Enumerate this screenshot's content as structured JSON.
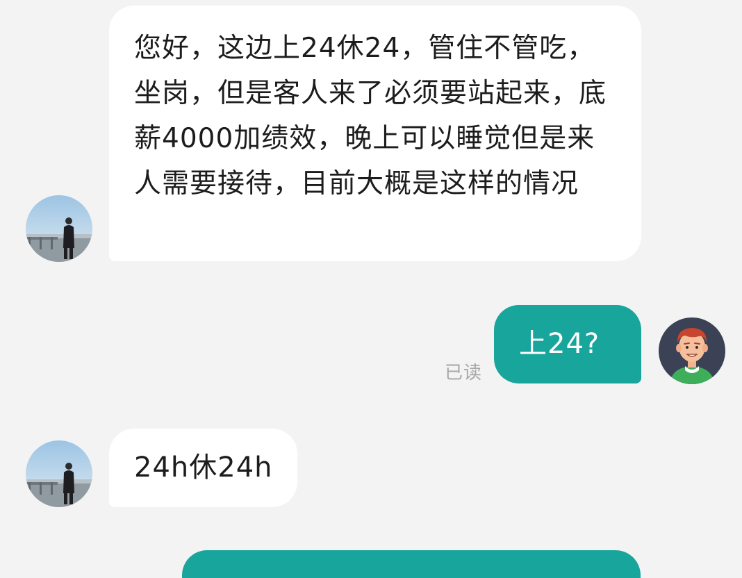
{
  "messages": [
    {
      "sender": "contact",
      "text": "您好，这边上24休24，管住不管吃，坐岗，但是客人来了必须要站起来，底薪4000加绩效，晚上可以睡觉但是来人需要接待，目前大概是这样的情况"
    },
    {
      "sender": "me",
      "text": "上24?",
      "status": "已读"
    },
    {
      "sender": "contact",
      "text": "24h休24h"
    }
  ],
  "colors": {
    "background": "#f3f3f3",
    "incoming_bubble": "#ffffff",
    "outgoing_bubble": "#18a59b",
    "read_status": "#a6a6a6"
  },
  "icons": {
    "contact_avatar": "photo-avatar-person-by-railing",
    "my_avatar": "cartoon-avatar-red-hair-green-shirt"
  }
}
